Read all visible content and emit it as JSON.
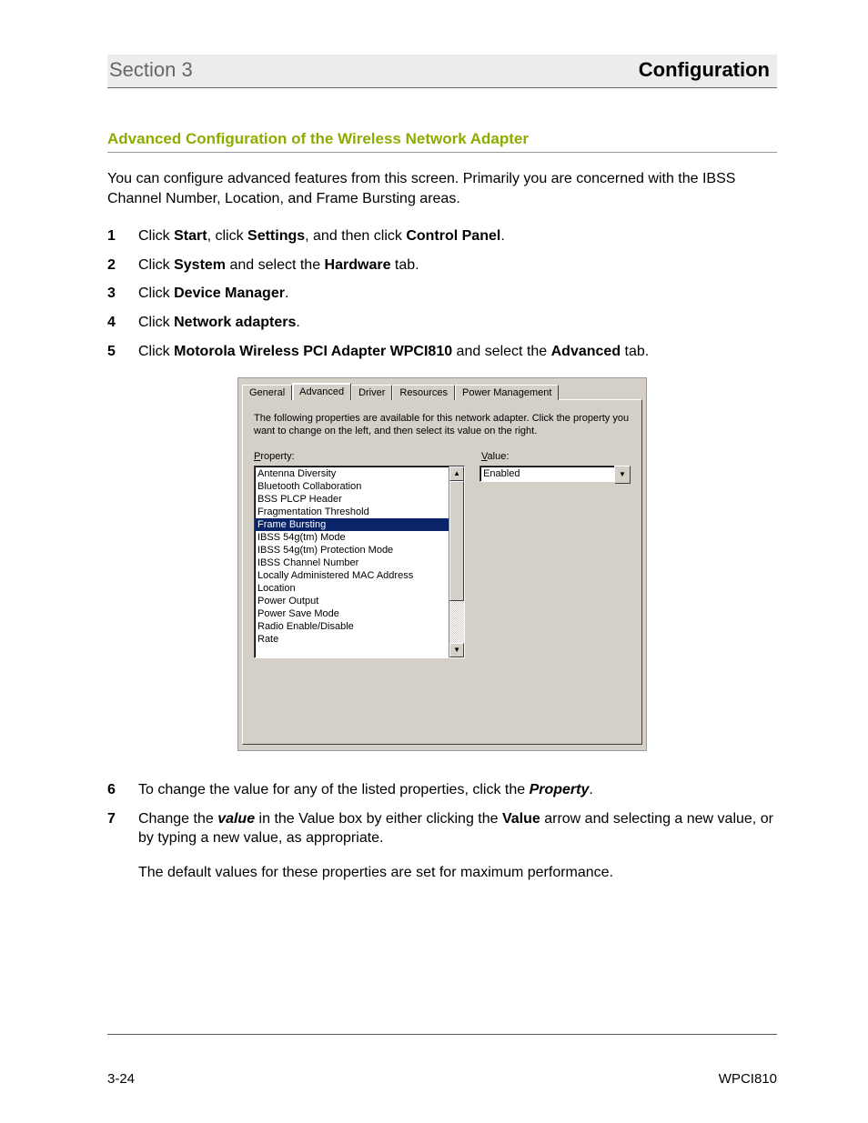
{
  "header": {
    "section": "Section 3",
    "title": "Configuration"
  },
  "heading": "Advanced Configuration of the Wireless Network Adapter",
  "intro": "You can configure advanced features from this screen. Primarily you are concerned with the IBSS Channel Number, Location, and Frame Bursting areas.",
  "steps": {
    "s1a": "Click ",
    "s1b": "Start",
    "s1c": ", click ",
    "s1d": "Settings",
    "s1e": ", and then click ",
    "s1f": "Control Panel",
    "s1g": ".",
    "s2a": "Click ",
    "s2b": "System",
    "s2c": " and select the ",
    "s2d": "Hardware",
    "s2e": " tab.",
    "s3a": "Click ",
    "s3b": "Device Manager",
    "s3c": ".",
    "s4a": "Click ",
    "s4b": "Network adapters",
    "s4c": ".",
    "s5a": "Click ",
    "s5b": "Motorola Wireless PCI Adapter WPCI810",
    "s5c": " and select the ",
    "s5d": "Advanced",
    "s5e": " tab.",
    "s6a": "To change the value for any of the listed properties, click the ",
    "s6b": "Property",
    "s6c": ".",
    "s7a": "Change the ",
    "s7b": "value",
    "s7c": " in the Value box by either clicking the ",
    "s7d": "Value",
    "s7e": " arrow and selecting a new value, or by typing a new value, as appropriate."
  },
  "after_note": "The default values for these properties are set for maximum performance.",
  "dialog": {
    "tabs": {
      "general": "General",
      "advanced": "Advanced",
      "driver": "Driver",
      "resources": "Resources",
      "power": "Power Management"
    },
    "description": "The following properties are available for this network adapter. Click the property you want to change on the left, and then select its value on the right.",
    "property_label_pre": "P",
    "property_label_rest": "roperty:",
    "value_label_pre": "V",
    "value_label_rest": "alue:",
    "properties": [
      "Antenna Diversity",
      "Bluetooth Collaboration",
      "BSS PLCP Header",
      "Fragmentation Threshold",
      "Frame Bursting",
      "IBSS 54g(tm) Mode",
      "IBSS 54g(tm) Protection Mode",
      "IBSS Channel Number",
      "Locally Administered MAC Address",
      "Location",
      "Power Output",
      "Power Save Mode",
      "Radio Enable/Disable",
      "Rate"
    ],
    "selected_index": 4,
    "value": "Enabled"
  },
  "footer": {
    "left": "3-24",
    "right": "WPCI810"
  }
}
